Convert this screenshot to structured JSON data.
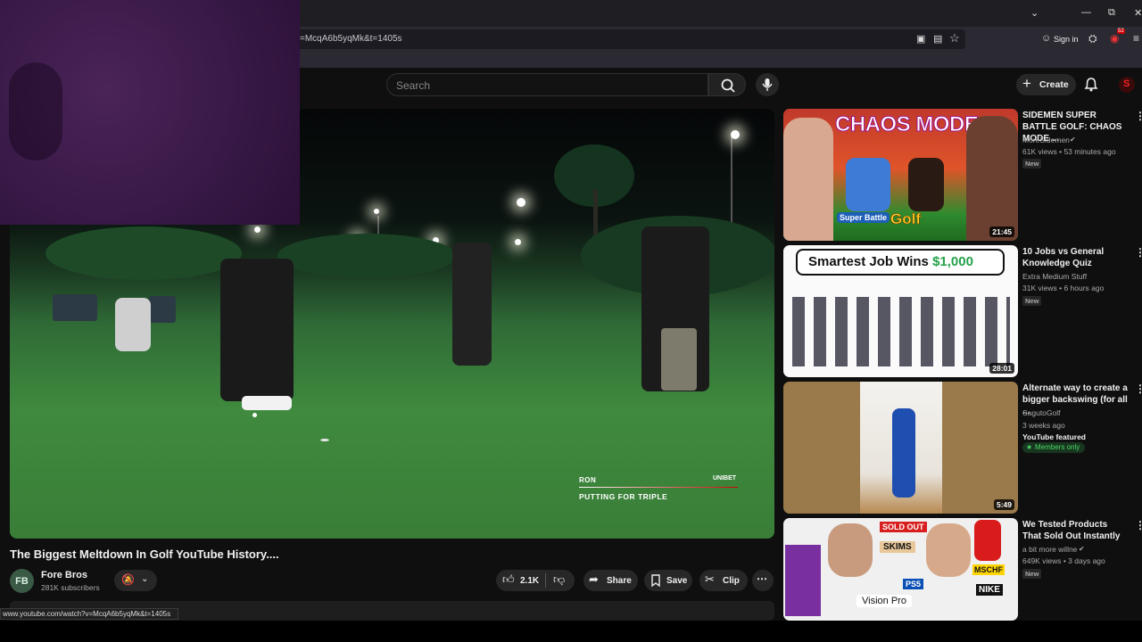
{
  "browser": {
    "url_text": "=McqA6b5yqMk&t=1405s",
    "sign_in_label": "Sign in",
    "status_url": "www.youtube.com/watch?v=McqA6b5yqMk&t=1405s",
    "extension_badge": "52"
  },
  "header": {
    "search_placeholder": "Search",
    "create_label": "Create"
  },
  "video": {
    "overlay_name": "RON",
    "overlay_brand": "UNIBET",
    "overlay_caption": "PUTTING FOR TRIPLE",
    "title": "The Biggest Meltdown In Golf YouTube History....",
    "channel_name": "Fore Bros",
    "channel_initials": "FB",
    "subscribers": "281K subscribers",
    "like_count": "2.1K",
    "share_label": "Share",
    "save_label": "Save",
    "clip_label": "Clip"
  },
  "sidebar": {
    "items": [
      {
        "title": "SIDEMEN SUPER BATTLE GOLF: CHAOS MODE ...",
        "channel": "MoreSidemen",
        "meta": "61K views • 53 minutes ago",
        "badge": "New",
        "duration": "21:45",
        "thumb_text": "CHAOS MODE",
        "thumb_logo_1": "Super Battle",
        "thumb_logo_2": "Golf"
      },
      {
        "title": "10 Jobs vs General Knowledge Quiz",
        "channel": "Extra Medium Stuff",
        "meta": "31K views • 6 hours ago",
        "badge": "New",
        "duration": "28:01",
        "thumb_text_a": "Smartest Job Wins ",
        "thumb_text_b": "$1,000"
      },
      {
        "title": "Alternate way to create a bigger backswing (for all ...",
        "channel": "SagutoGolf",
        "meta": "3 weeks ago",
        "featured": "YouTube featured",
        "members": "Members only",
        "duration": "5:49"
      },
      {
        "title": "We Tested Products That Sold Out Instantly",
        "channel": "a bit more willne",
        "meta": "649K views • 3 days ago",
        "badge": "New",
        "thumb_sold": "SOLD OUT",
        "thumb_skims": "SKIMS",
        "thumb_ps": "PS5",
        "thumb_vision": "Vision Pro",
        "thumb_mschf": "MSCHF",
        "thumb_nike": "NIKE"
      }
    ]
  }
}
